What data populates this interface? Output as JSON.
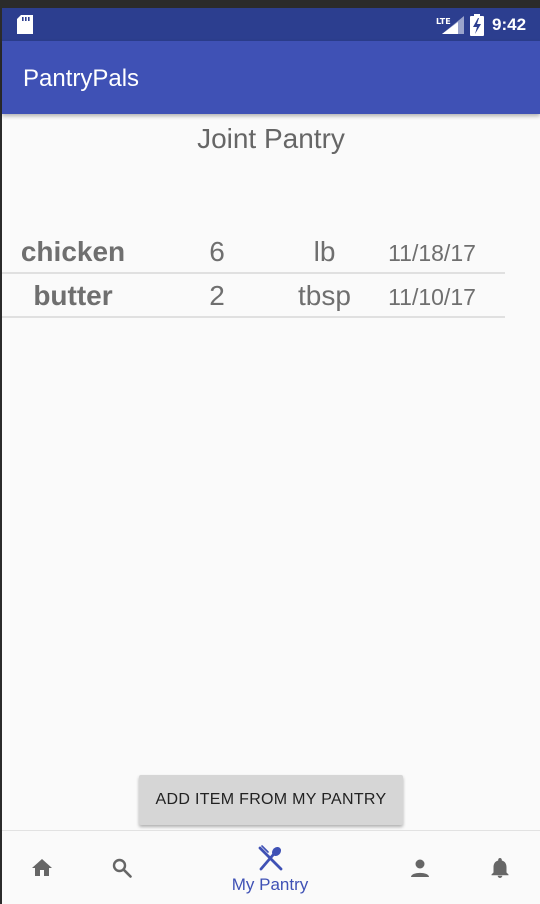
{
  "status_bar": {
    "network": "LTE",
    "time": "9:42"
  },
  "app_bar": {
    "title": "PantryPals"
  },
  "pantry": {
    "title": "Joint Pantry",
    "items": [
      {
        "name": "chicken",
        "quantity": "6",
        "unit": "lb",
        "date": "11/18/17"
      },
      {
        "name": "butter",
        "quantity": "2",
        "unit": "tbsp",
        "date": "11/10/17"
      }
    ]
  },
  "add_button": {
    "label": "ADD ITEM FROM MY PANTRY"
  },
  "bottom_nav": {
    "items": [
      {
        "icon": "home-icon"
      },
      {
        "icon": "search-icon"
      },
      {
        "icon": "utensils-icon",
        "label": "My Pantry",
        "active": true
      },
      {
        "icon": "person-icon"
      },
      {
        "icon": "bell-icon"
      }
    ]
  },
  "colors": {
    "status_bar": "#2c3e8f",
    "app_bar": "#3f51b5",
    "accent": "#3f51b5",
    "text_gray": "#6f6f6f",
    "button_bg": "#d6d6d6",
    "inactive_icon": "#666666"
  }
}
